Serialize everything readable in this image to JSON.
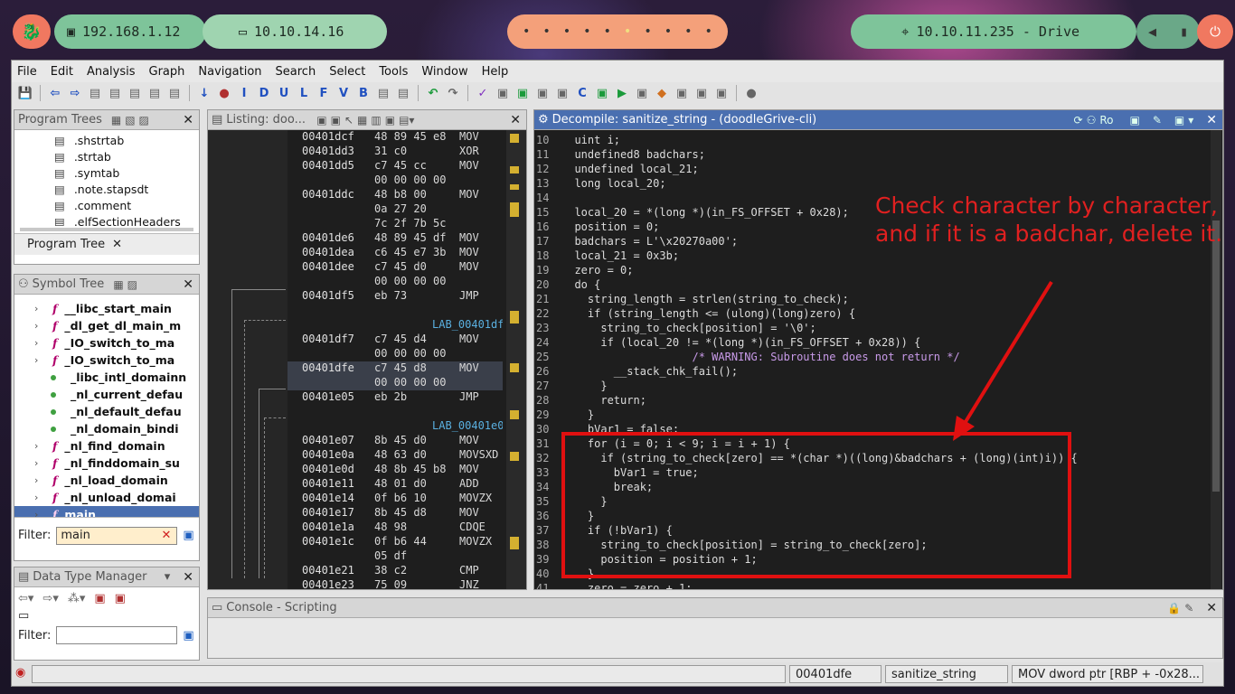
{
  "topbar": {
    "logo_glyph": "🐉",
    "ip1": "192.168.1.12",
    "ip2": "10.10.14.16",
    "workspaces": [
      "•",
      "•",
      "•",
      "•",
      "•",
      "•",
      "•",
      "•",
      "•",
      "•"
    ],
    "target": "10.10.11.235 - Drive",
    "power_glyph": "⏻"
  },
  "menu": [
    "File",
    "Edit",
    "Analysis",
    "Graph",
    "Navigation",
    "Search",
    "Select",
    "Tools",
    "Window",
    "Help"
  ],
  "toolbar": {
    "icons": [
      "💾",
      "⇦",
      "⇨",
      "▤",
      "▤",
      "▤",
      "▤",
      "▤",
      "↓",
      "●",
      "I",
      "D",
      "U",
      "L",
      "F",
      "V",
      "B",
      "▤",
      "▤",
      "↶",
      "↷",
      "✓",
      "▣",
      "▣",
      "▣",
      "▣",
      "C",
      "▣",
      "▶",
      "▣",
      "◆",
      "▣",
      "▣",
      "▣",
      "●"
    ]
  },
  "program_trees": {
    "title": "Program Trees",
    "items": [
      ".shstrtab",
      ".strtab",
      ".symtab",
      ".note.stapsdt",
      ".comment",
      ".elfSectionHeaders"
    ],
    "tab_label": "Program Tree"
  },
  "symbol_tree": {
    "title": "Symbol Tree",
    "items": [
      {
        "name": "__libc_start_main",
        "kind": "func",
        "expand": true
      },
      {
        "name": "_dl_get_dl_main_m",
        "kind": "func",
        "expand": true
      },
      {
        "name": "_IO_switch_to_ma",
        "kind": "func",
        "expand": true
      },
      {
        "name": "_IO_switch_to_ma",
        "kind": "func",
        "expand": true
      },
      {
        "name": "_libc_intl_domainn",
        "kind": "data",
        "expand": false
      },
      {
        "name": "_nl_current_defau",
        "kind": "data",
        "expand": false
      },
      {
        "name": "_nl_default_defau",
        "kind": "data",
        "expand": false
      },
      {
        "name": "_nl_domain_bindi",
        "kind": "data",
        "expand": false
      },
      {
        "name": "_nl_find_domain",
        "kind": "func",
        "expand": true
      },
      {
        "name": "_nl_finddomain_su",
        "kind": "func",
        "expand": true
      },
      {
        "name": "_nl_load_domain",
        "kind": "func",
        "expand": true
      },
      {
        "name": "_nl_unload_domai",
        "kind": "func",
        "expand": true
      },
      {
        "name": "main",
        "kind": "func",
        "expand": true,
        "selected": true
      }
    ],
    "filter_label": "Filter:",
    "filter_value": "main"
  },
  "data_type_manager": {
    "title": "Data Type Manager",
    "filter_label": "Filter:",
    "filter_value": ""
  },
  "listing": {
    "title": "Listing:  doo...",
    "rows": [
      {
        "addr": "00401dcf",
        "bytes": "48 89 45 e8",
        "mnem": "MOV"
      },
      {
        "addr": "00401dd3",
        "bytes": "31 c0",
        "mnem": "XOR"
      },
      {
        "addr": "00401dd5",
        "bytes": "c7 45 cc",
        "mnem": "MOV"
      },
      {
        "addr": "",
        "bytes": "00 00 00 00",
        "mnem": ""
      },
      {
        "addr": "00401ddc",
        "bytes": "48 b8 00",
        "mnem": "MOV"
      },
      {
        "addr": "",
        "bytes": "0a 27 20",
        "mnem": ""
      },
      {
        "addr": "",
        "bytes": "7c 2f 7b 5c",
        "mnem": ""
      },
      {
        "addr": "00401de6",
        "bytes": "48 89 45 df",
        "mnem": "MOV"
      },
      {
        "addr": "00401dea",
        "bytes": "c6 45 e7 3b",
        "mnem": "MOV"
      },
      {
        "addr": "00401dee",
        "bytes": "c7 45 d0",
        "mnem": "MOV"
      },
      {
        "addr": "",
        "bytes": "00 00 00 00",
        "mnem": ""
      },
      {
        "addr": "00401df5",
        "bytes": "eb 73",
        "mnem": "JMP"
      },
      {
        "addr": "",
        "bytes": "",
        "mnem": ""
      },
      {
        "label": "LAB_00401df"
      },
      {
        "addr": "00401df7",
        "bytes": "c7 45 d4",
        "mnem": "MOV"
      },
      {
        "addr": "",
        "bytes": "00 00 00 00",
        "mnem": ""
      },
      {
        "addr": "00401dfe",
        "bytes": "c7 45 d8",
        "mnem": "MOV",
        "hl": true
      },
      {
        "addr": "",
        "bytes": "00 00 00 00",
        "mnem": "",
        "hl": true
      },
      {
        "addr": "00401e05",
        "bytes": "eb 2b",
        "mnem": "JMP"
      },
      {
        "addr": "",
        "bytes": "",
        "mnem": ""
      },
      {
        "label": "LAB_00401e0"
      },
      {
        "addr": "00401e07",
        "bytes": "8b 45 d0",
        "mnem": "MOV"
      },
      {
        "addr": "00401e0a",
        "bytes": "48 63 d0",
        "mnem": "MOVSXD"
      },
      {
        "addr": "00401e0d",
        "bytes": "48 8b 45 b8",
        "mnem": "MOV"
      },
      {
        "addr": "00401e11",
        "bytes": "48 01 d0",
        "mnem": "ADD"
      },
      {
        "addr": "00401e14",
        "bytes": "0f b6 10",
        "mnem": "MOVZX"
      },
      {
        "addr": "00401e17",
        "bytes": "8b 45 d8",
        "mnem": "MOV"
      },
      {
        "addr": "00401e1a",
        "bytes": "48 98",
        "mnem": "CDQE"
      },
      {
        "addr": "00401e1c",
        "bytes": "0f b6 44",
        "mnem": "MOVZX"
      },
      {
        "addr": "",
        "bytes": "05 df",
        "mnem": ""
      },
      {
        "addr": "00401e21",
        "bytes": "38 c2",
        "mnem": "CMP"
      },
      {
        "addr": "00401e23",
        "bytes": "75 09",
        "mnem": "JNZ"
      }
    ]
  },
  "decompile": {
    "title": "Decompile: sanitize_string -  (doodleGrive-cli)",
    "lines": [
      {
        "n": "10",
        "t": "  uint i;"
      },
      {
        "n": "11",
        "t": "  undefined8 badchars;"
      },
      {
        "n": "12",
        "t": "  undefined local_21;"
      },
      {
        "n": "13",
        "t": "  long local_20;"
      },
      {
        "n": "14",
        "t": ""
      },
      {
        "n": "15",
        "t": "  local_20 = *(long *)(in_FS_OFFSET + 0x28);"
      },
      {
        "n": "16",
        "t": "  position = 0;"
      },
      {
        "n": "17",
        "t": "  badchars = L'\\x20270a00';"
      },
      {
        "n": "18",
        "t": "  local_21 = 0x3b;"
      },
      {
        "n": "19",
        "t": "  zero = 0;"
      },
      {
        "n": "20",
        "t": "  do {"
      },
      {
        "n": "21",
        "t": "    string_length = strlen(string_to_check);"
      },
      {
        "n": "22",
        "t": "    if (string_length <= (ulong)(long)zero) {"
      },
      {
        "n": "23",
        "t": "      string_to_check[position] = '\\0';"
      },
      {
        "n": "24",
        "t": "      if (local_20 != *(long *)(in_FS_OFFSET + 0x28)) {"
      },
      {
        "n": "25",
        "t": "                    /* WARNING: Subroutine does not return */"
      },
      {
        "n": "26",
        "t": "        __stack_chk_fail();"
      },
      {
        "n": "27",
        "t": "      }"
      },
      {
        "n": "28",
        "t": "      return;"
      },
      {
        "n": "29",
        "t": "    }"
      },
      {
        "n": "30",
        "t": "    bVar1 = false;"
      },
      {
        "n": "31",
        "t": "    for (i = 0; i < 9; i = i + 1) {"
      },
      {
        "n": "32",
        "t": "      if (string_to_check[zero] == *(char *)((long)&badchars + (long)(int)i)) {"
      },
      {
        "n": "33",
        "t": "        bVar1 = true;"
      },
      {
        "n": "34",
        "t": "        break;"
      },
      {
        "n": "35",
        "t": "      }"
      },
      {
        "n": "36",
        "t": "    }"
      },
      {
        "n": "37",
        "t": "    if (!bVar1) {"
      },
      {
        "n": "38",
        "t": "      string_to_check[position] = string_to_check[zero];"
      },
      {
        "n": "39",
        "t": "      position = position + 1;"
      },
      {
        "n": "40",
        "t": "    }"
      },
      {
        "n": "41",
        "t": "    zero = zero + 1;"
      }
    ]
  },
  "annotation": {
    "line1": "Check character by character,",
    "line2": "and if it is a badchar, delete it."
  },
  "console": {
    "title": "Console - Scripting"
  },
  "statusbar": {
    "address": "00401dfe",
    "function": "sanitize_string",
    "instruction": "MOV dword ptr [RBP + -0x28..."
  },
  "colors": {
    "accent": "#4a6fb0",
    "annotation": "#e01010"
  }
}
